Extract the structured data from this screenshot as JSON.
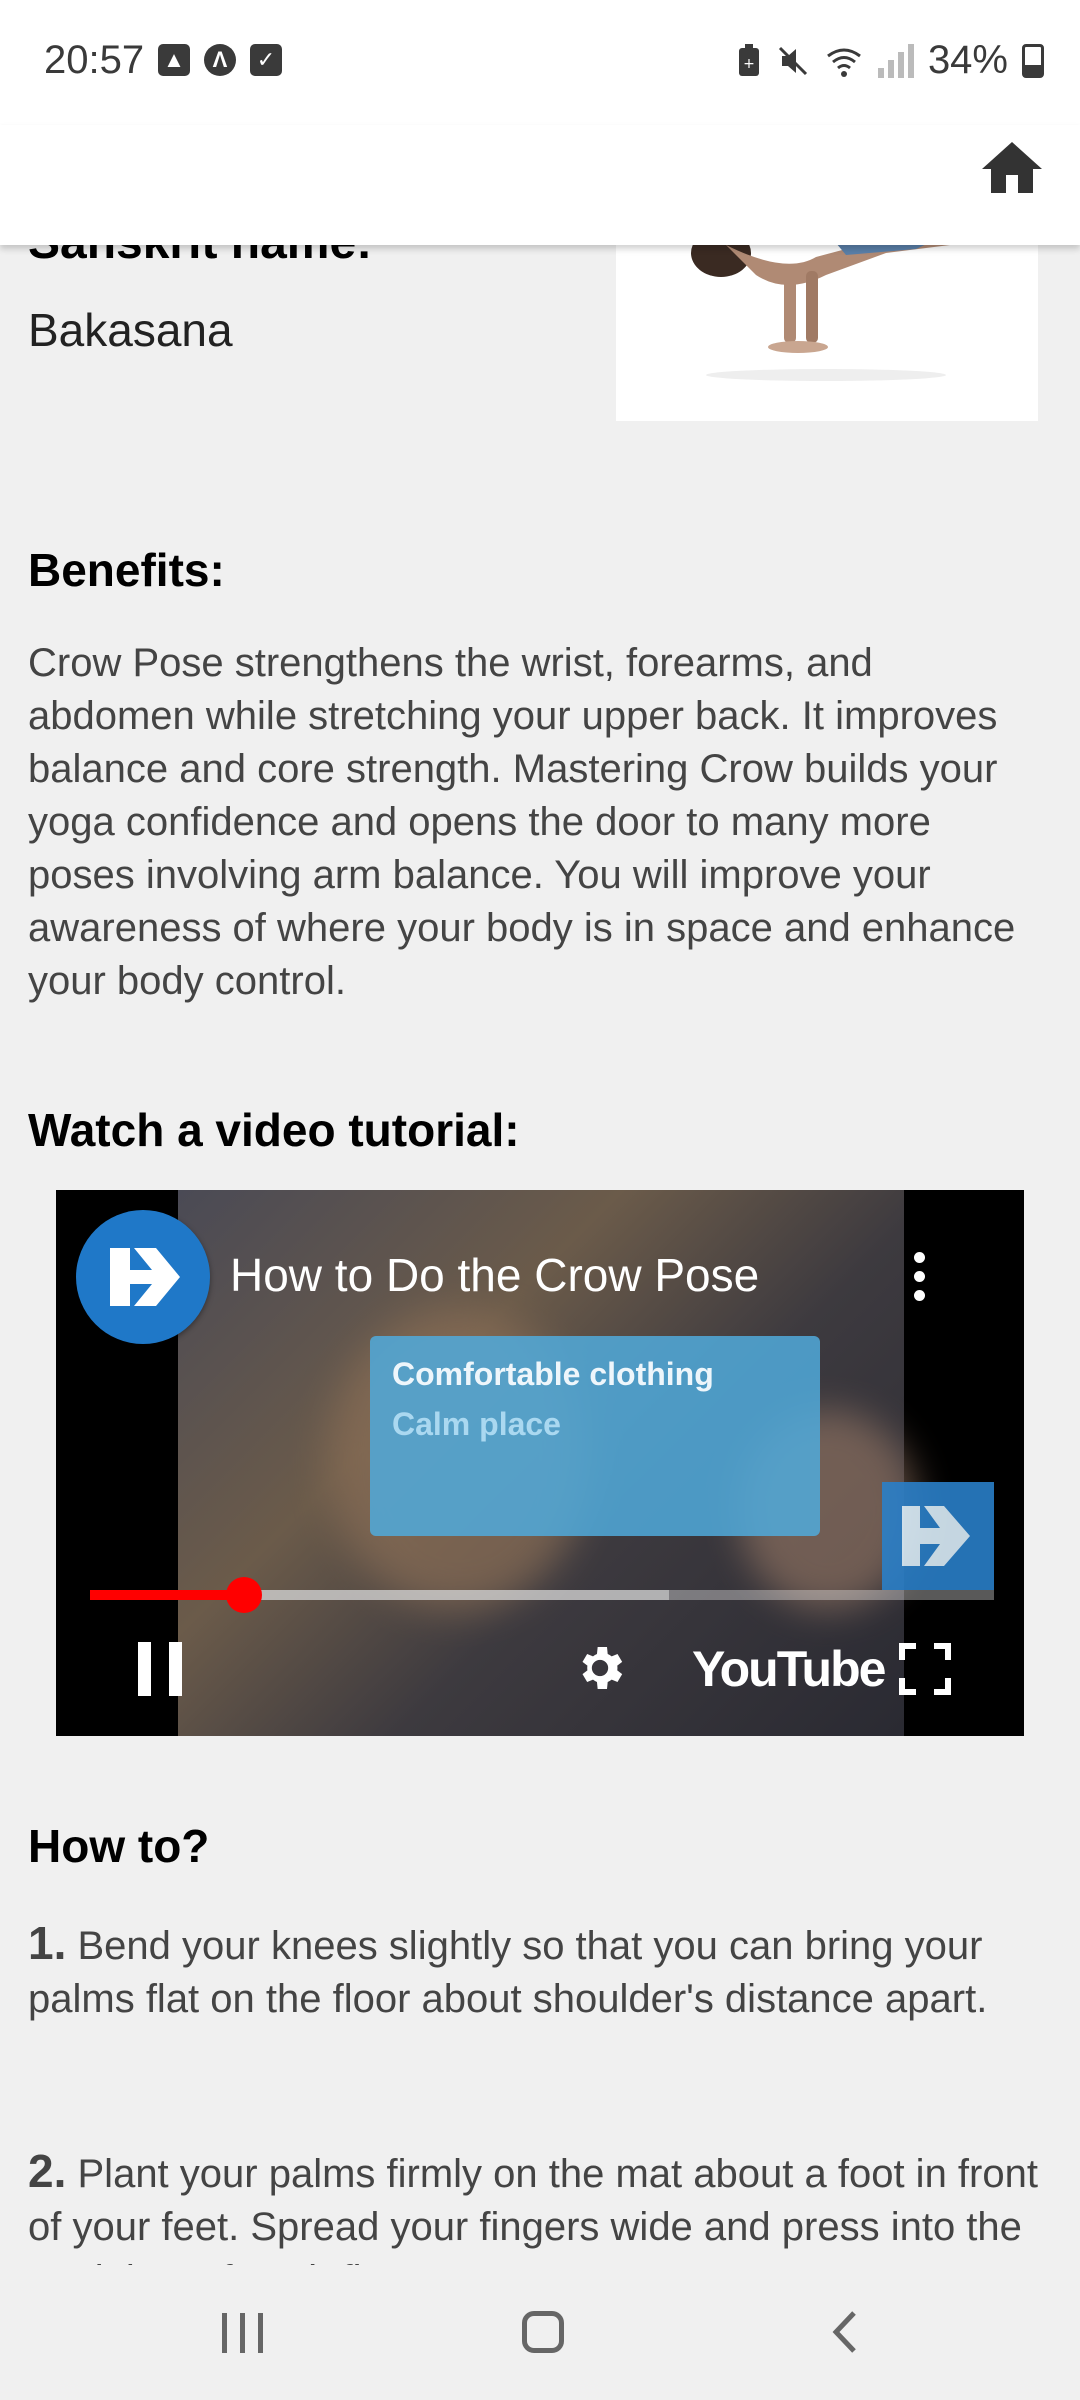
{
  "status_bar": {
    "time": "20:57",
    "battery": "34%"
  },
  "content": {
    "partial_label": "Sanskrit name:",
    "sanskrit_name": "Bakasana",
    "benefits_title": "Benefits:",
    "benefits_text": "Crow Pose strengthens the wrist, forearms, and abdomen while stretching your upper back. It improves balance and core strength. Mastering Crow builds your yoga confidence and opens the door to many more poses involving arm balance. You will improve your awareness of where your body is in space and enhance your body control.",
    "video_heading": "Watch a video tutorial:",
    "howto_title": "How to?",
    "steps": [
      {
        "num": "1.",
        "text": "Bend your knees slightly so that you can bring your palms flat on the floor about shoulder's distance apart."
      },
      {
        "num": "2.",
        "text": "Plant your palms firmly on the mat about a foot in front of your feet. Spread your fingers wide and press into the top joints of each finger."
      }
    ]
  },
  "video": {
    "title": "How to Do the Crow Pose",
    "card_line1": "Comfortable clothing",
    "card_line2": "Calm place",
    "brand": "YouTube",
    "progress_played": 0.17,
    "progress_buffered": 0.64
  },
  "colors": {
    "accent": "#ff0000",
    "channel_blue": "#1f78c8"
  }
}
